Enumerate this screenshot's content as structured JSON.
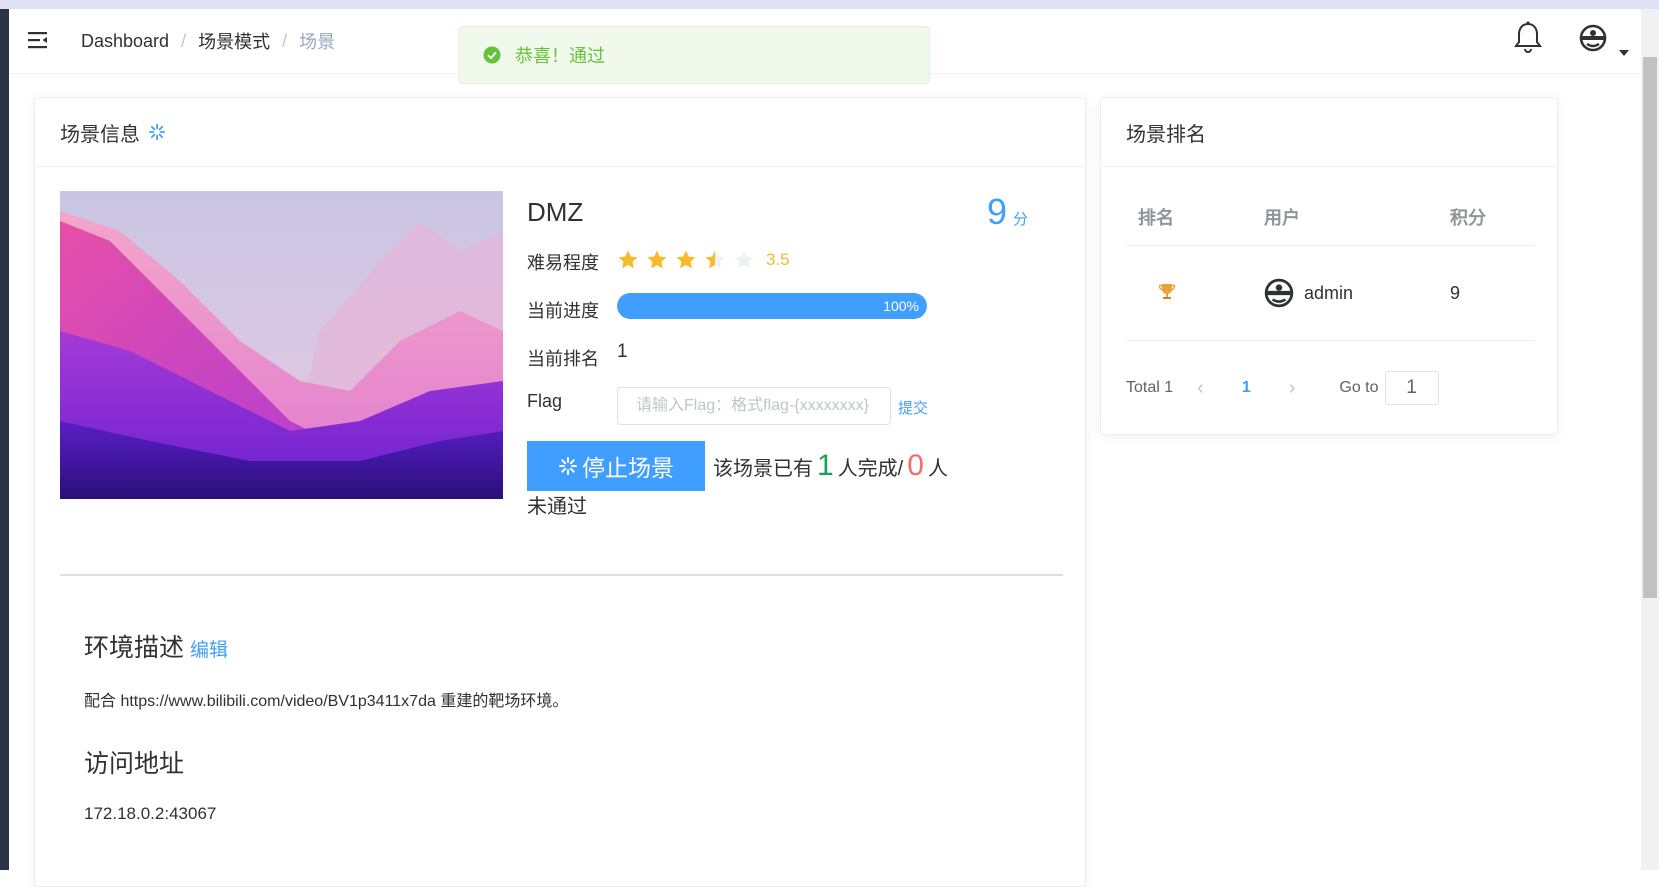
{
  "breadcrumb": {
    "items": [
      "Dashboard",
      "场景模式"
    ],
    "current": "场景",
    "separator": "/"
  },
  "message": {
    "text": "恭喜！通过",
    "type": "success"
  },
  "scene_card": {
    "header": "场景信息",
    "name": "DMZ",
    "score": "9",
    "score_unit": "分",
    "difficulty_label": "难易程度",
    "difficulty_value": 3.5,
    "difficulty_text": "3.5",
    "progress_label": "当前进度",
    "progress_percent": 100,
    "progress_text": "100%",
    "rank_label": "当前排名",
    "rank_value": "1",
    "flag_label": "Flag",
    "flag_placeholder": "请输入Flag：格式flag-{xxxxxxxx}",
    "submit_label": "提交",
    "stop_label": "停止场景",
    "stat_prefix": "该场景已有",
    "completed_count": "1",
    "stat_mid": "人完成/",
    "failed_count": "0",
    "stat_suffix": "人未通过"
  },
  "description": {
    "title": "环境描述",
    "edit_label": "编辑",
    "text": "配合 https://www.bilibili.com/video/BV1p3411x7da 重建的靶场环境。"
  },
  "access": {
    "title": "访问地址",
    "address": "172.18.0.2:43067"
  },
  "ranking_card": {
    "header": "场景排名",
    "columns": [
      "排名",
      "用户",
      "积分"
    ],
    "rows": [
      {
        "rank_icon": "trophy-icon",
        "user": "admin",
        "points": "9"
      }
    ],
    "total_text": "Total 1",
    "current_page": "1",
    "goto_label": "Go to",
    "goto_value": "1"
  },
  "colors": {
    "primary": "#409eff",
    "success": "#67c23a",
    "green": "#13a452",
    "danger": "#f56c6c",
    "star": "#f7ba2a"
  }
}
